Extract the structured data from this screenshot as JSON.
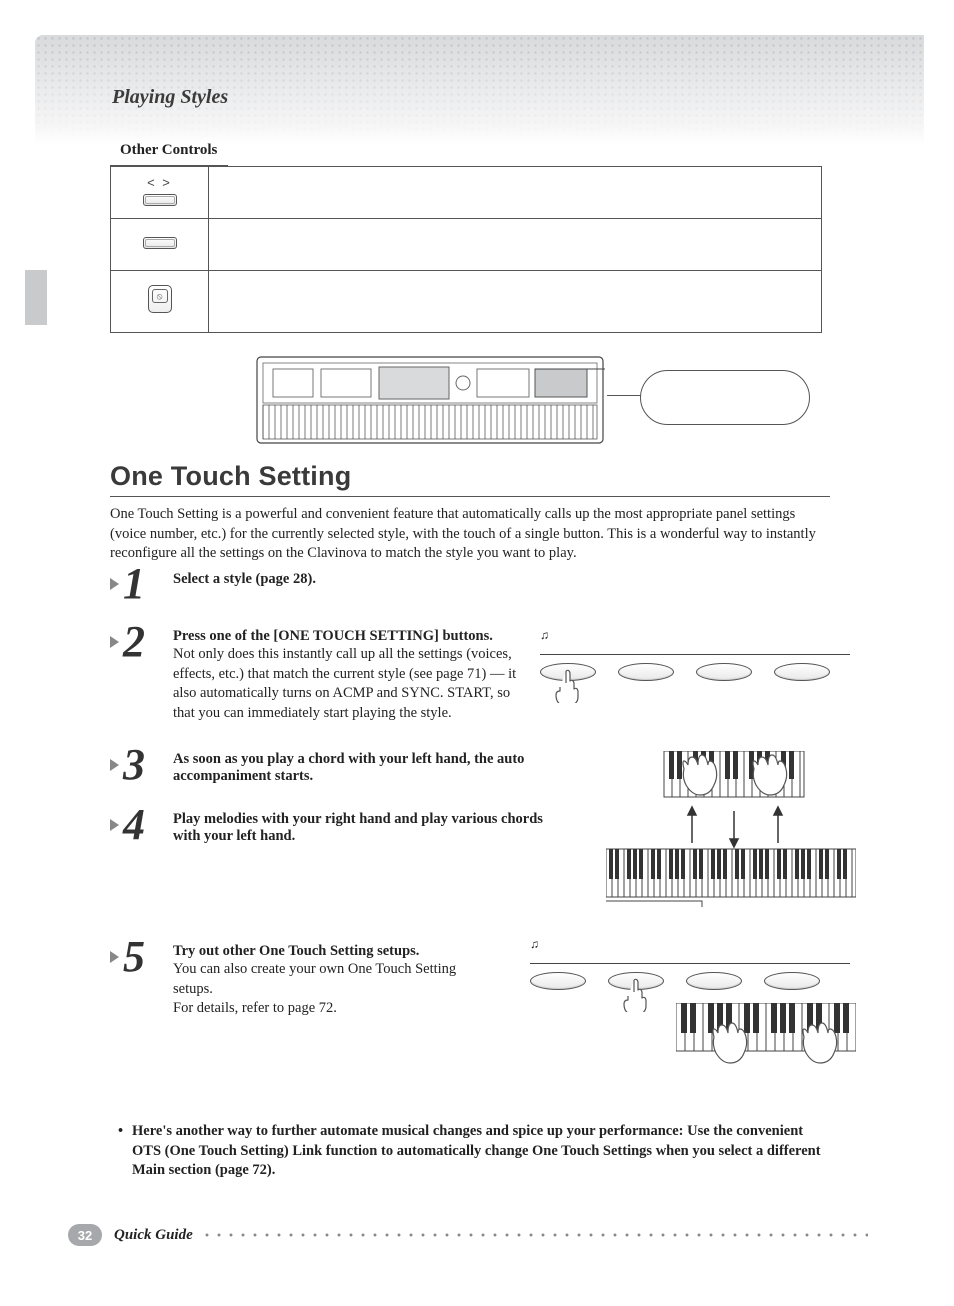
{
  "header": {
    "section": "Playing Styles",
    "table_caption": "Other Controls",
    "angle_label": "< >"
  },
  "heading": "One Touch Setting",
  "intro": "One Touch Setting is a powerful and convenient feature that automatically calls up the most appropriate panel settings (voice number, etc.) for the currently selected style, with the touch of a single button. This is a wonderful way to instantly reconfigure all the settings on the Clavinova to match the style you want to play.",
  "steps": {
    "s1": {
      "title": "Select a style (page 28)."
    },
    "s2": {
      "title": "Press one of the [ONE TOUCH SETTING] buttons.",
      "body": "Not only does this instantly call up all the settings (voices, effects, etc.) that match the current style (see page 71) — it also automatically turns on ACMP and SYNC. START, so that you can immediately start playing the style."
    },
    "s3": {
      "title": "As soon as you play a chord with your left hand, the auto accompaniment starts."
    },
    "s4": {
      "title": "Play melodies with your right hand and play various chords with your left hand."
    },
    "s5": {
      "title": "Try out other One Touch Setting setups.",
      "body1": "You can also create your own One Touch Setting setups.",
      "body2": "For details, refer to page 72."
    }
  },
  "note": "Here's another way to further automate musical changes and spice up your performance: Use the convenient OTS (One Touch Setting) Link function to automatically change One Touch Settings when you select a different Main section (page 72).",
  "footer": {
    "page": "32",
    "guide": "Quick Guide"
  }
}
